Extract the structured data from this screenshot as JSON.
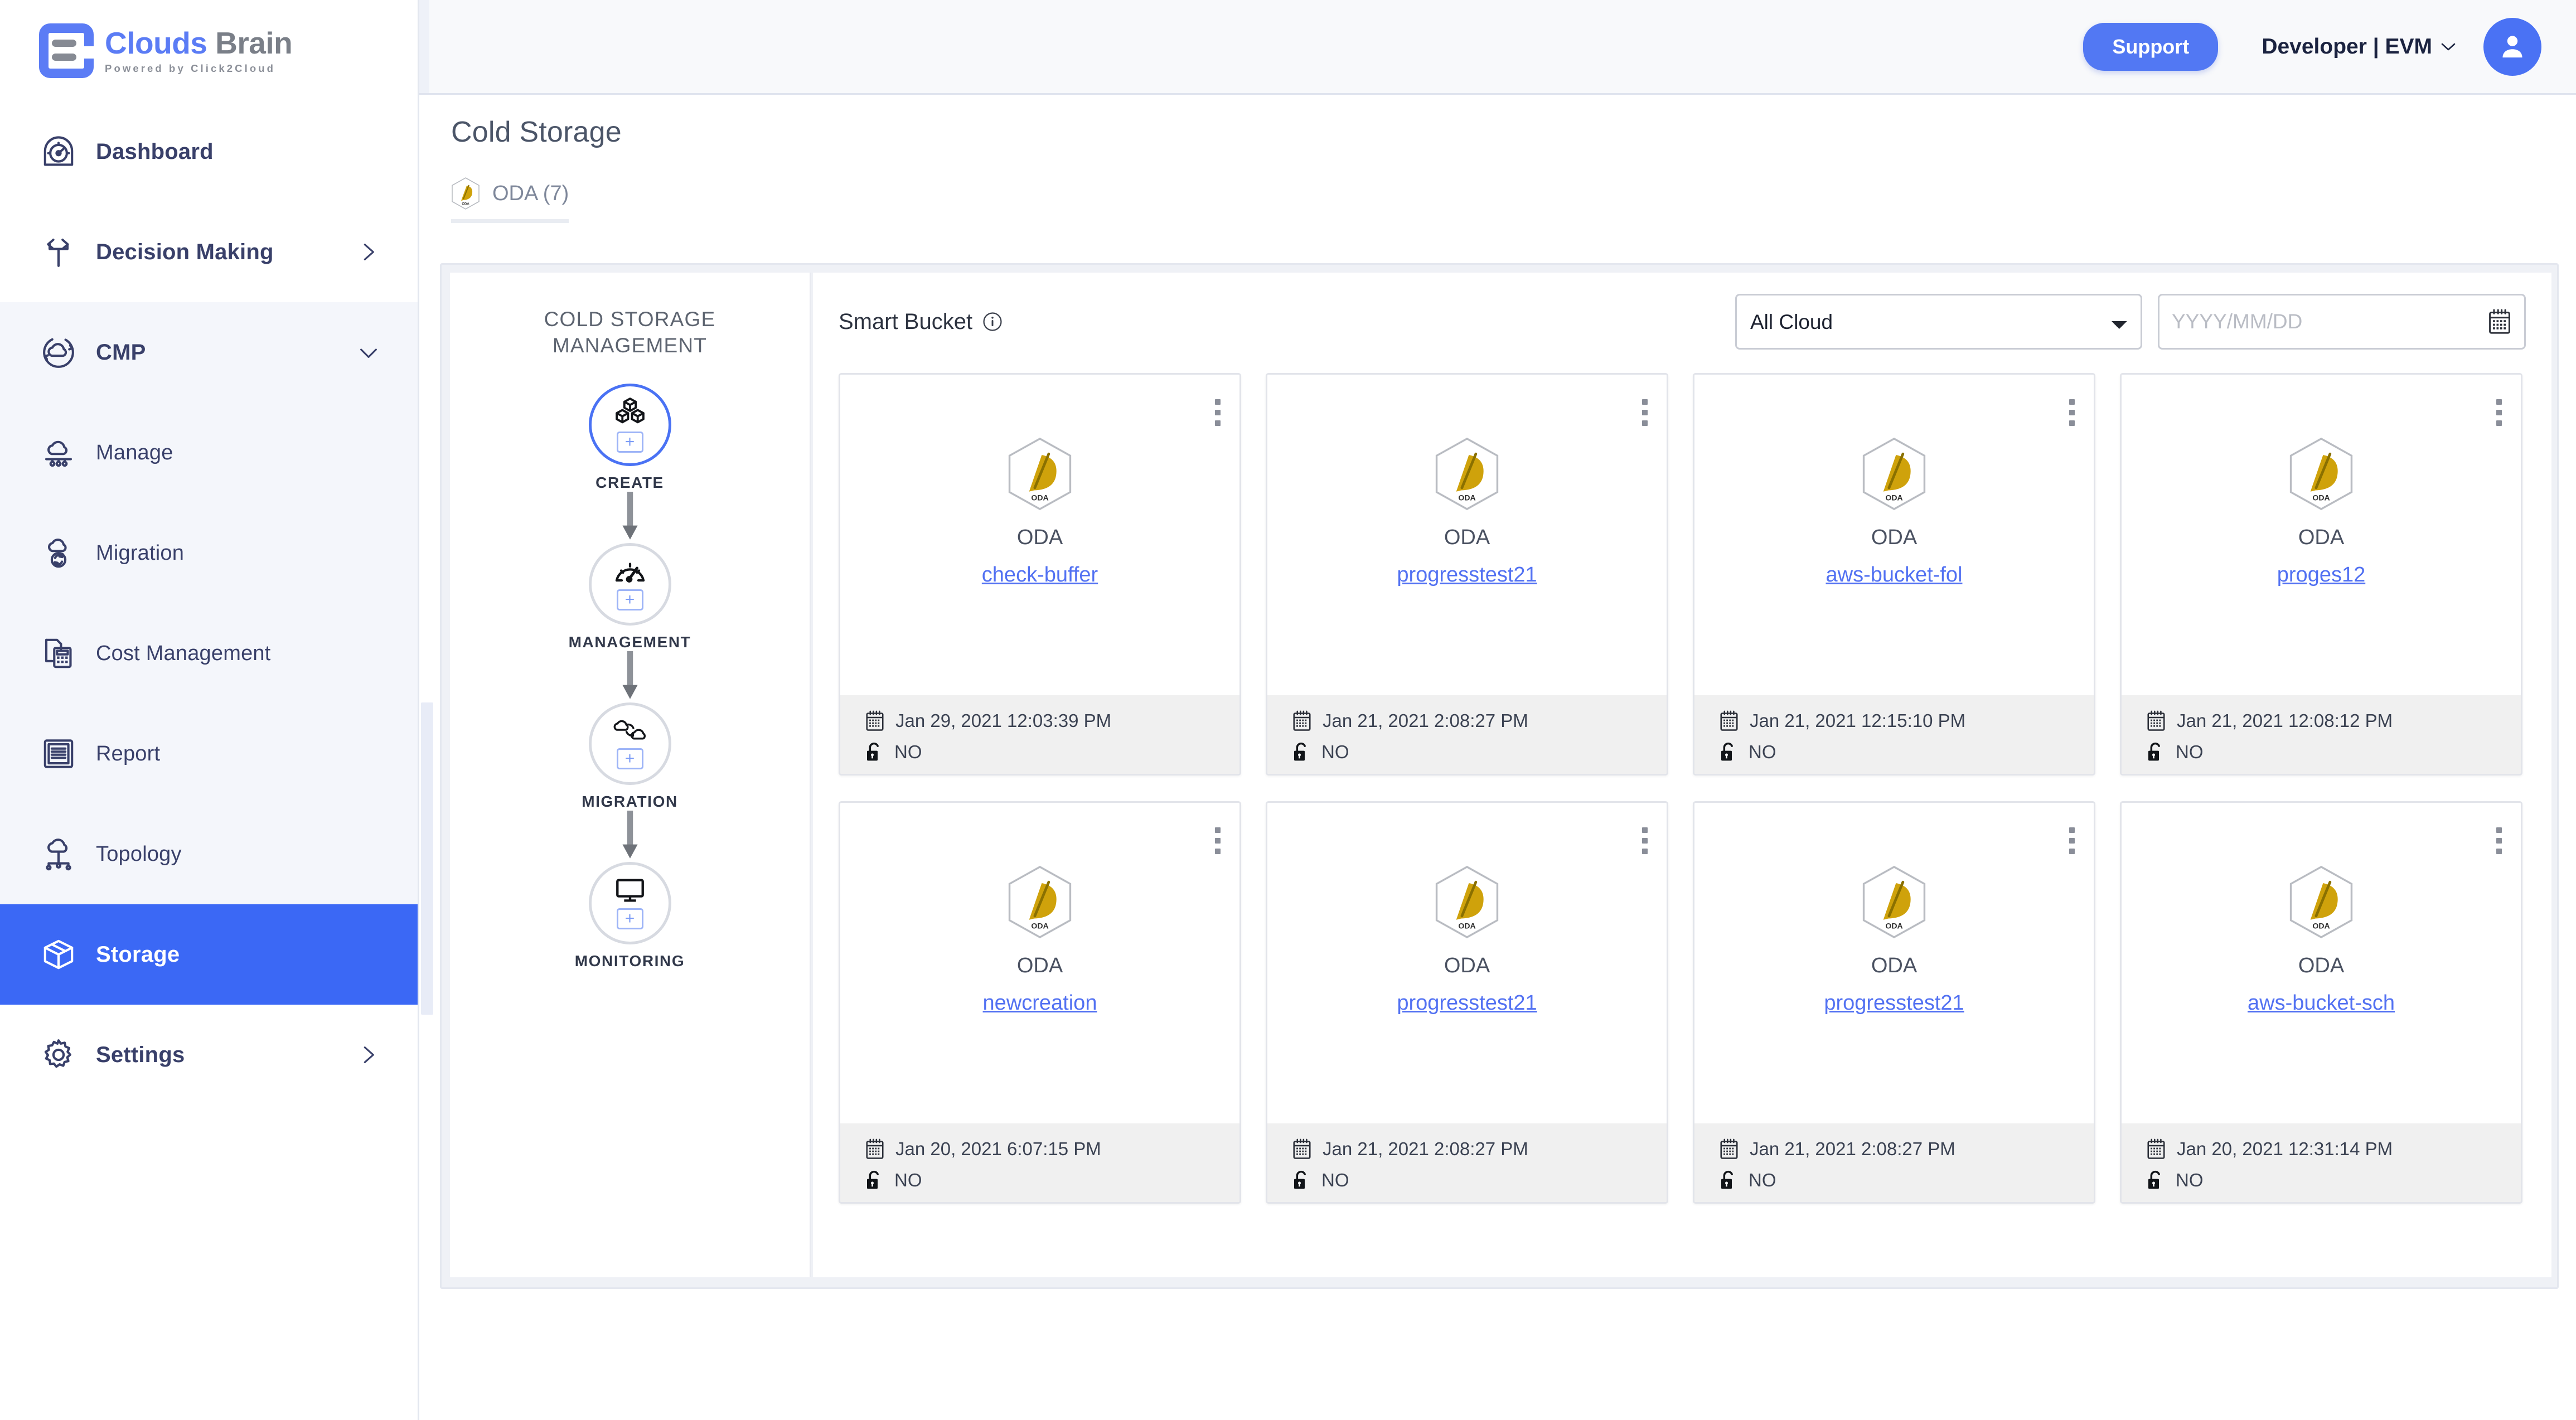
{
  "brand": {
    "title_part1": "Clouds",
    "title_part2": "Brain",
    "tagline": "Powered by Click2Cloud",
    "accent": "#5b7cf5"
  },
  "sidebar": {
    "items": [
      {
        "label": "Dashboard",
        "icon": "dashboard-gauge-icon",
        "chevron": "",
        "state": "plain",
        "bold": true
      },
      {
        "label": "Decision Making",
        "icon": "decision-fork-icon",
        "chevron": "right",
        "state": "plain",
        "bold": true
      },
      {
        "label": "CMP",
        "icon": "cloud-sync-icon",
        "chevron": "down",
        "state": "shade",
        "bold": true
      },
      {
        "label": "Manage",
        "icon": "cloud-manage-icon",
        "chevron": "",
        "state": "shade",
        "bold": false
      },
      {
        "label": "Migration",
        "icon": "cloud-migration-icon",
        "chevron": "",
        "state": "shade",
        "bold": false
      },
      {
        "label": "Cost Management",
        "icon": "cost-calculator-icon",
        "chevron": "",
        "state": "shade",
        "bold": false
      },
      {
        "label": "Report",
        "icon": "report-icon",
        "chevron": "",
        "state": "shade",
        "bold": false
      },
      {
        "label": "Topology",
        "icon": "topology-icon",
        "chevron": "",
        "state": "shade",
        "bold": false
      },
      {
        "label": "Storage",
        "icon": "storage-box-icon",
        "chevron": "",
        "state": "active",
        "bold": true
      },
      {
        "label": "Settings",
        "icon": "gear-icon",
        "chevron": "right",
        "state": "plain",
        "bold": true
      }
    ],
    "active_color": "#3b68f5"
  },
  "header": {
    "support_label": "Support",
    "user_label": "Developer | EVM",
    "support_color": "#5278f3",
    "avatar_color": "#4a72f4"
  },
  "page": {
    "title": "Cold Storage",
    "tab_label": "ODA (7)"
  },
  "flow": {
    "title_line1": "COLD STORAGE",
    "title_line2": "MANAGEMENT",
    "nodes": [
      {
        "label": "CREATE",
        "icon": "cubes-icon",
        "active": true,
        "plus": "+"
      },
      {
        "label": "MANAGEMENT",
        "icon": "gauge-icon",
        "active": false,
        "plus": "+"
      },
      {
        "label": "MIGRATION",
        "icon": "clouds-swap-icon",
        "active": false,
        "plus": "+"
      },
      {
        "label": "MONITORING",
        "icon": "monitor-icon",
        "active": false,
        "plus": "+"
      }
    ]
  },
  "bucket_panel": {
    "title": "Smart Bucket",
    "info_icon": "info-circle-icon",
    "cloud_filter": {
      "selected": "All Cloud",
      "options": [
        "All Cloud"
      ]
    },
    "date_filter": {
      "value": "",
      "placeholder": "YYYY/MM/DD",
      "icon": "calendar-icon"
    },
    "cards": [
      {
        "provider": "ODA",
        "name": "check-buffer",
        "date": "Jan 29, 2021 12:03:39 PM",
        "locked": "NO"
      },
      {
        "provider": "ODA",
        "name": "progresstest21",
        "date": "Jan 21, 2021 2:08:27 PM",
        "locked": "NO"
      },
      {
        "provider": "ODA",
        "name": "aws-bucket-fol",
        "date": "Jan 21, 2021 12:15:10 PM",
        "locked": "NO"
      },
      {
        "provider": "ODA",
        "name": "proges12",
        "date": "Jan 21, 2021 12:08:12 PM",
        "locked": "NO"
      },
      {
        "provider": "ODA",
        "name": "newcreation",
        "date": "Jan 20, 2021 6:07:15 PM",
        "locked": "NO"
      },
      {
        "provider": "ODA",
        "name": "progresstest21",
        "date": "Jan 21, 2021 2:08:27 PM",
        "locked": "NO"
      },
      {
        "provider": "ODA",
        "name": "progresstest21",
        "date": "Jan 21, 2021 2:08:27 PM",
        "locked": "NO"
      },
      {
        "provider": "ODA",
        "name": "aws-bucket-sch",
        "date": "Jan 20, 2021 12:31:14 PM",
        "locked": "NO"
      }
    ],
    "link_color": "#5271f2",
    "logo_gold": "#d1a100"
  }
}
